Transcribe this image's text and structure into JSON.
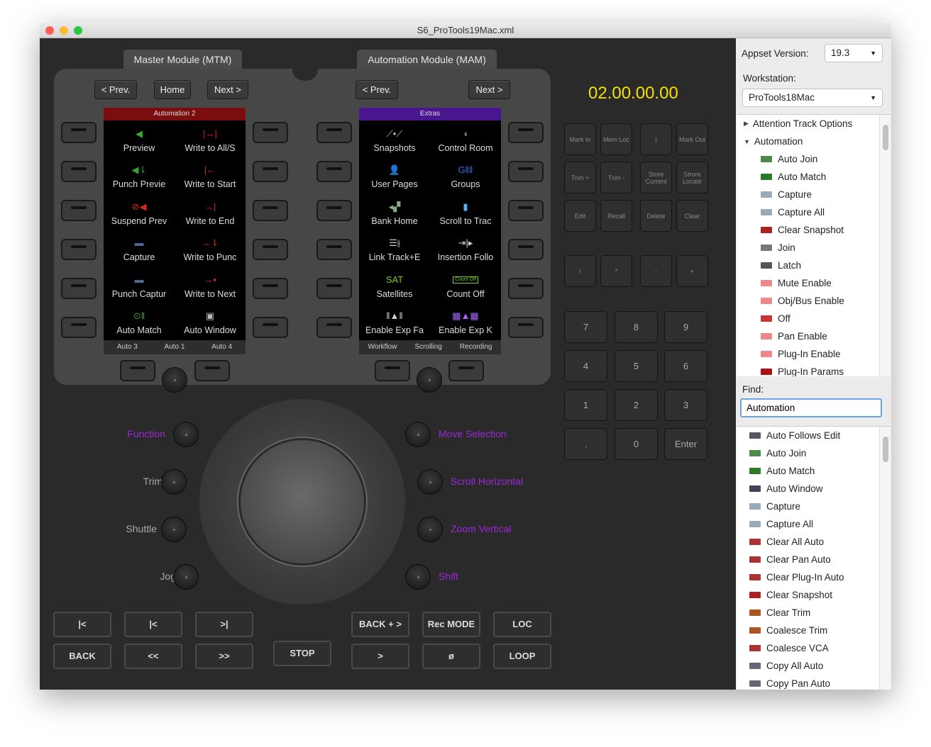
{
  "window": {
    "title": "S6_ProTools19Mac.xml"
  },
  "tabs": [
    "Master Module (MTM)",
    "Automation Module (MAM)"
  ],
  "nav": {
    "prev": "< Prev.",
    "home": "Home",
    "next": "Next >"
  },
  "screens": [
    {
      "header": "Automation 2",
      "header_color": "#7a0e0e",
      "cells": [
        {
          "label": "Preview",
          "icon": "speaker-icon",
          "glyph": "◀",
          "color": "#2eaa2e"
        },
        {
          "label": "Write to All/S",
          "icon": "write-all-icon",
          "glyph": "|↔|",
          "color": "#d22"
        },
        {
          "label": "Punch Previe",
          "icon": "punch-preview-icon",
          "glyph": "◀⇂",
          "color": "#2eaa2e"
        },
        {
          "label": "Write to Start",
          "icon": "write-start-icon",
          "glyph": "|←",
          "color": "#d22"
        },
        {
          "label": "Suspend Prev",
          "icon": "suspend-preview-icon",
          "glyph": "⊘◀",
          "color": "#d22"
        },
        {
          "label": "Write to End",
          "icon": "write-end-icon",
          "glyph": "→|",
          "color": "#d22"
        },
        {
          "label": "Capture",
          "icon": "capture-icon",
          "glyph": "▬",
          "color": "#4a6a9a"
        },
        {
          "label": "Write to Punc",
          "icon": "write-punch-icon",
          "glyph": "→⇂",
          "color": "#d22"
        },
        {
          "label": "Punch Captur",
          "icon": "punch-capture-icon",
          "glyph": "▬",
          "color": "#4a6a9a"
        },
        {
          "label": "Write to Next",
          "icon": "write-next-icon",
          "glyph": "→▪",
          "color": "#d22"
        },
        {
          "label": "Auto Match",
          "icon": "auto-match-icon",
          "glyph": "⊙‖",
          "color": "#2eaa2e"
        },
        {
          "label": "Auto Window",
          "icon": "auto-window-icon",
          "glyph": "▣",
          "color": "#bbb"
        }
      ],
      "footer": [
        "Auto 3",
        "Auto 1",
        "Auto 4"
      ]
    },
    {
      "header": "Extras",
      "header_color": "#4a1690",
      "cells": [
        {
          "label": "Snapshots",
          "icon": "snapshots-icon",
          "glyph": "⟋•⟋",
          "color": "#bbb"
        },
        {
          "label": "Control Room",
          "icon": "control-room-icon",
          "glyph": "◖",
          "color": "#888"
        },
        {
          "label": "User Pages",
          "icon": "user-pages-icon",
          "glyph": "👤",
          "color": "#ddd"
        },
        {
          "label": "Groups",
          "icon": "groups-icon",
          "glyph": "G‖‖",
          "color": "#3a6ae0"
        },
        {
          "label": "Bank Home",
          "icon": "bank-home-icon",
          "glyph": "◂▞",
          "color": "#8a8"
        },
        {
          "label": "Scroll to Trac",
          "icon": "scroll-track-icon",
          "glyph": "▮",
          "color": "#5ab0f0"
        },
        {
          "label": "Link Track+E",
          "icon": "link-track-icon",
          "glyph": "☰⫲",
          "color": "#ccc"
        },
        {
          "label": "Insertion Follo",
          "icon": "insertion-follow-icon",
          "glyph": "⇥|▸",
          "color": "#ccc"
        },
        {
          "label": "Satellites",
          "icon": "satellites-icon",
          "glyph": "SAT",
          "color": "#7c2"
        },
        {
          "label": "Count Off",
          "icon": "count-off-icon",
          "glyph": "Count Off",
          "color": "#7c2"
        },
        {
          "label": "Enable Exp Fa",
          "icon": "enable-exp-faders-icon",
          "glyph": "‖▲‖",
          "color": "#ccc"
        },
        {
          "label": "Enable Exp K",
          "icon": "enable-exp-knobs-icon",
          "glyph": "▦▲▦",
          "color": "#a6f"
        }
      ],
      "footer": [
        "Workflow",
        "Scrolling",
        "Recording"
      ]
    }
  ],
  "knobs": {
    "left": [
      "Function",
      "Trim",
      "Shuttle",
      "Jog"
    ],
    "right": [
      "Move Selection",
      "Scroll Horizontal",
      "Zoom Vertical",
      "Shift"
    ],
    "accent": "#9a28d8"
  },
  "transport": {
    "row1": [
      "|<",
      "|<",
      ">|",
      "BACK + >",
      "Rec MODE",
      "LOC"
    ],
    "row2": [
      "BACK",
      "<<",
      ">>",
      "STOP",
      ">",
      "ø",
      "LOOP"
    ]
  },
  "timecode": "02.00.00.00",
  "keypad": {
    "top": [
      "Mark In",
      "Mem Loc",
      "|",
      "Mark Out",
      "Trim   +",
      "Trim   -",
      "Store Current",
      "Strore Locate",
      "Edit",
      "Recall",
      "Delete",
      "Clear",
      "/",
      "*",
      "-",
      "+"
    ],
    "numbers": [
      "7",
      "8",
      "9",
      "4",
      "5",
      "6",
      "1",
      "2",
      "3",
      ".",
      "0",
      "Enter"
    ]
  },
  "panel": {
    "appset_label": "Appset Version:",
    "appset_value": "19.3",
    "workstation_label": "Workstation:",
    "workstation_value": "ProTools18Mac",
    "find_label": "Find:",
    "find_value": "Automation",
    "tree": [
      {
        "label": "Attention Track Options",
        "level": 0,
        "arrow": "▶"
      },
      {
        "label": "Automation",
        "level": 0,
        "arrow": "▼"
      },
      {
        "label": "Auto Join",
        "level": 1,
        "color": "#4a8a4a"
      },
      {
        "label": "Auto Match",
        "level": 1,
        "color": "#2a7a2a"
      },
      {
        "label": "Capture",
        "level": 1,
        "color": "#9ab"
      },
      {
        "label": "Capture All",
        "level": 1,
        "color": "#9ab"
      },
      {
        "label": "Clear Snapshot",
        "level": 1,
        "color": "#a22"
      },
      {
        "label": "Join",
        "level": 1,
        "color": "#777"
      },
      {
        "label": "Latch",
        "level": 1,
        "color": "#555"
      },
      {
        "label": "Mute Enable",
        "level": 1,
        "color": "#e88"
      },
      {
        "label": "Obj/Bus Enable",
        "level": 1,
        "color": "#e88"
      },
      {
        "label": "Off",
        "level": 1,
        "color": "#c33"
      },
      {
        "label": "Pan Enable",
        "level": 1,
        "color": "#e88"
      },
      {
        "label": "Plug-In Enable",
        "level": 1,
        "color": "#e88"
      },
      {
        "label": "Plug-In Params",
        "level": 1,
        "color": "#a11"
      }
    ],
    "results": [
      {
        "label": "Auto Follows Edit",
        "color": "#556"
      },
      {
        "label": "Auto Join",
        "color": "#4a8a4a"
      },
      {
        "label": "Auto Match",
        "color": "#2a7a2a"
      },
      {
        "label": "Auto Window",
        "color": "#445"
      },
      {
        "label": "Capture",
        "color": "#9ab"
      },
      {
        "label": "Capture All",
        "color": "#9ab"
      },
      {
        "label": "Clear All Auto",
        "color": "#a33"
      },
      {
        "label": "Clear Pan Auto",
        "color": "#a33"
      },
      {
        "label": "Clear Plug-In Auto",
        "color": "#a33"
      },
      {
        "label": "Clear Snapshot",
        "color": "#a22"
      },
      {
        "label": "Clear Trim",
        "color": "#a52"
      },
      {
        "label": "Coalesce Trim",
        "color": "#a52"
      },
      {
        "label": "Coalesce VCA",
        "color": "#a33"
      },
      {
        "label": "Copy All Auto",
        "color": "#667"
      },
      {
        "label": "Copy Pan Auto",
        "color": "#667"
      }
    ]
  }
}
